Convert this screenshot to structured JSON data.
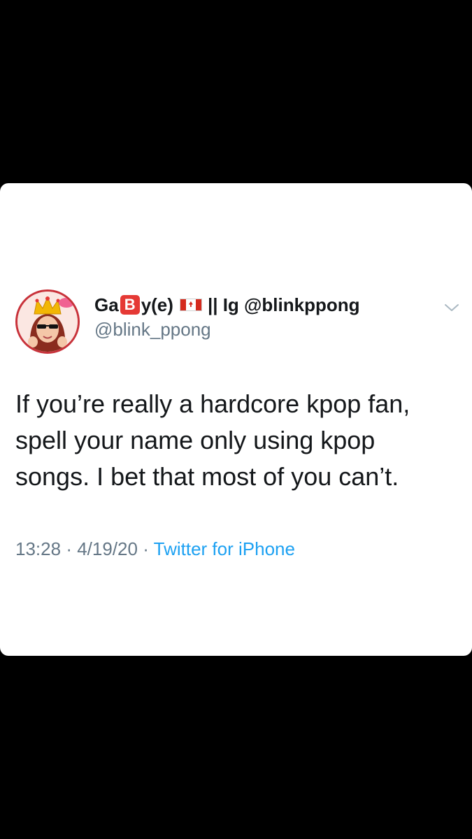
{
  "tweet": {
    "author": {
      "name_prefix": "Ga",
      "name_badge": "B",
      "name_suffix": "y(e)",
      "name_tail": "|| Ig @blinkppong",
      "handle": "@blink_ppong",
      "flag_icon": "canada-flag-icon",
      "avatar_icon": "crowned-avatar-image"
    },
    "text": "If you’re really a hardcore kpop fan, spell your name only using kpop songs. I bet that most of you can’t.",
    "time": "13:28",
    "date": "4/19/20",
    "source": "Twitter for iPhone",
    "separator": "·",
    "menu_icon": "chevron-down-icon"
  },
  "colors": {
    "background": "#000000",
    "card": "#ffffff",
    "text": "#14171a",
    "muted": "#657786",
    "link": "#1da1f2",
    "badge": "#e53935"
  }
}
